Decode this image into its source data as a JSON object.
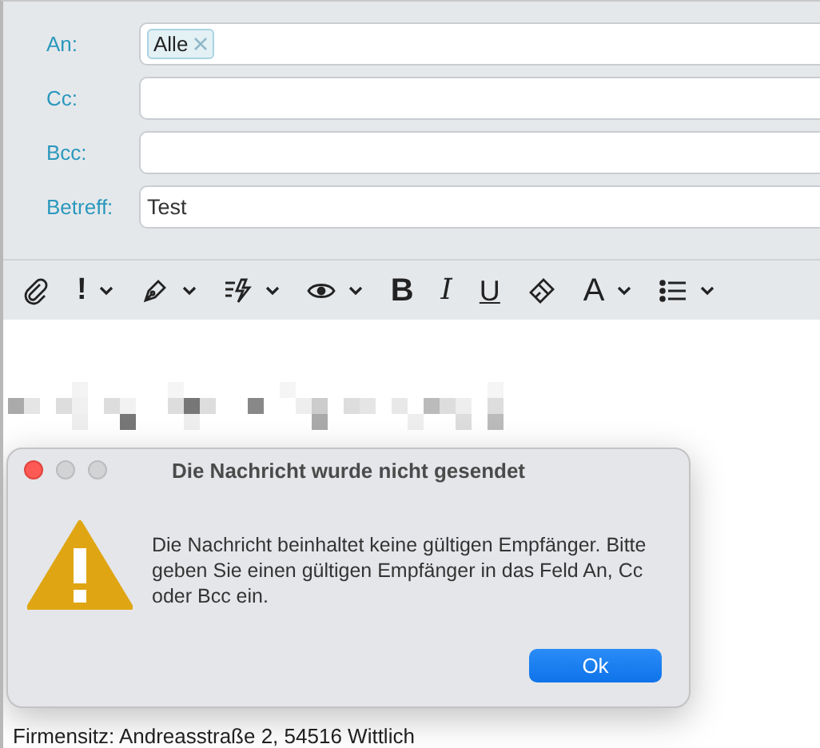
{
  "compose": {
    "fields": [
      {
        "label": "An:",
        "kind": "recipients",
        "tokens": [
          "Alle"
        ]
      },
      {
        "label": "Cc:",
        "kind": "text"
      },
      {
        "label": "Bcc:",
        "kind": "text"
      },
      {
        "label": "Betreff:",
        "kind": "text",
        "value": "Test"
      }
    ]
  },
  "toolbar": [
    {
      "kind": "attach",
      "menu": false
    },
    {
      "kind": "bang",
      "text": "!",
      "menu": true
    },
    {
      "kind": "pen",
      "menu": true
    },
    {
      "kind": "quick",
      "menu": true
    },
    {
      "kind": "eye",
      "menu": true
    },
    {
      "kind": "bold",
      "text": "B",
      "menu": false
    },
    {
      "kind": "italic",
      "text": "I",
      "menu": false
    },
    {
      "kind": "underline",
      "text": "U",
      "menu": false
    },
    {
      "kind": "brush",
      "menu": false
    },
    {
      "kind": "font",
      "text": "A",
      "menu": true
    },
    {
      "kind": "list",
      "menu": true
    }
  ],
  "body": {
    "footer_line": "Firmensitz: Andreasstraße 2, 54516 Wittlich"
  },
  "dialog": {
    "title": "Die Nachricht wurde nicht gesendet",
    "message": "Die Nachricht beinhaltet keine gültigen Empfänger. Bitte geben Sie einen gültigen Empfänger in das Feld An, Cc oder Bcc ein.",
    "button": "Ok"
  }
}
